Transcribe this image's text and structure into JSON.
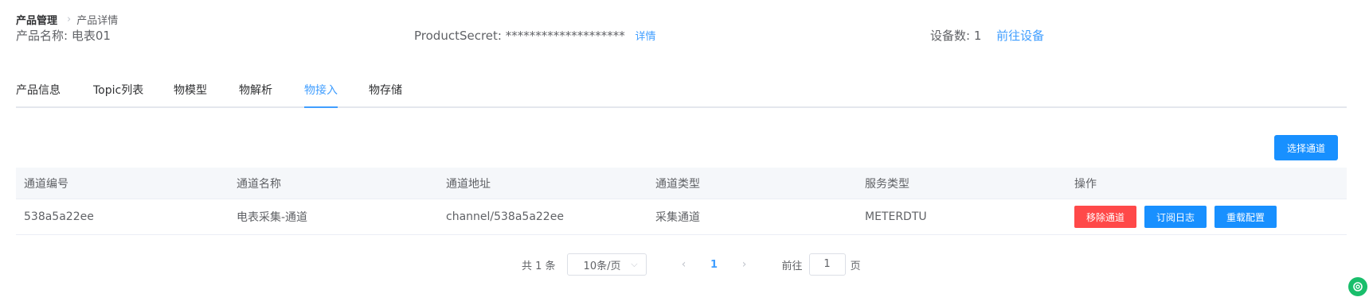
{
  "breadcrumb": {
    "root": "产品管理",
    "current": "产品详情"
  },
  "product": {
    "name_label": "产品名称: 电表01",
    "secret_label": "ProductSecret: ********************",
    "secret_detail_link": "详情",
    "device_count_label": "设备数: 1",
    "go_devices_link": "前往设备"
  },
  "tabs": [
    {
      "label": "产品信息",
      "active": false
    },
    {
      "label": "Topic列表",
      "active": false
    },
    {
      "label": "物模型",
      "active": false
    },
    {
      "label": "物解析",
      "active": false
    },
    {
      "label": "物接入",
      "active": true
    },
    {
      "label": "物存储",
      "active": false
    }
  ],
  "toolbar": {
    "select_channel_label": "选择通道"
  },
  "table": {
    "columns": [
      "通道编号",
      "通道名称",
      "通道地址",
      "通道类型",
      "服务类型",
      "操作"
    ],
    "rows": [
      {
        "id": "538a5a22ee",
        "name": "电表采集-通道",
        "address": "channel/538a5a22ee",
        "type": "采集通道",
        "service": "METERDTU",
        "actions": [
          "移除通道",
          "订阅日志",
          "重载配置"
        ]
      }
    ]
  },
  "pagination": {
    "total_label": "共 1 条",
    "page_size": "10条/页",
    "current_page": "1",
    "jump_label": "前往",
    "jump_value": "1",
    "jump_suffix": "页"
  },
  "colors": {
    "primary": "#1890ff",
    "link": "#409eff",
    "danger": "#ff4949",
    "float_icon": "#19be6b"
  },
  "icons": {
    "breadcrumb_separator": "chevron-right-icon",
    "select_arrow": "chevron-down-icon",
    "prev": "chevron-left-icon",
    "next": "chevron-right-icon",
    "float": "support-icon"
  }
}
